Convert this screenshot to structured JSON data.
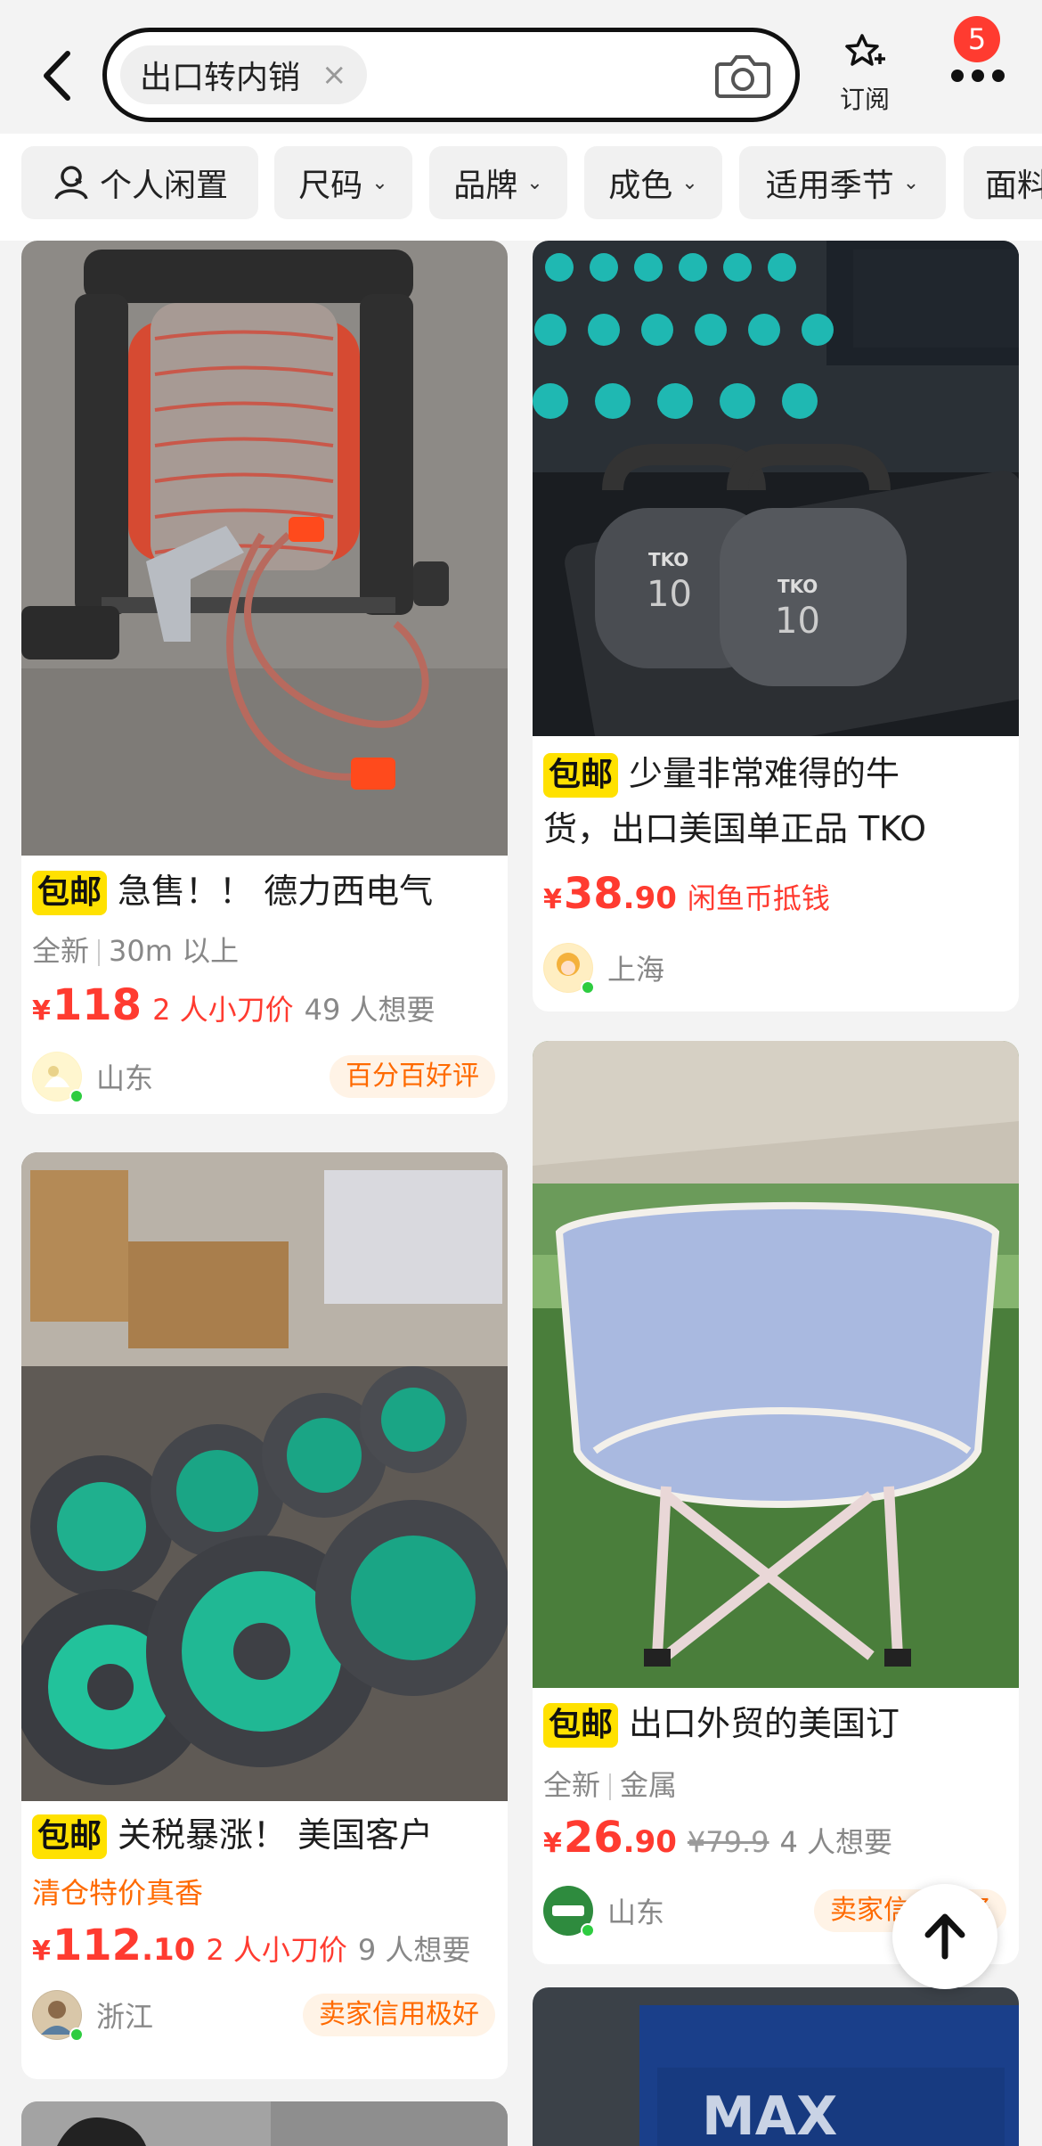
{
  "search": {
    "query": "出口转内销",
    "close_symbol": "×"
  },
  "header": {
    "subscribe_label": "订阅",
    "notification_count": "5"
  },
  "filters": [
    {
      "label": "个人闲置",
      "has_icon": true
    },
    {
      "label": "尺码"
    },
    {
      "label": "品牌"
    },
    {
      "label": "成色"
    },
    {
      "label": "适用季节"
    },
    {
      "label": "面料"
    }
  ],
  "caret": "⌄",
  "products": [
    {
      "tag": "包邮",
      "title": "急售！！ 德力西电气",
      "condition": "全新",
      "spec": "30m 以上",
      "yen": "¥",
      "price_int": "118",
      "price_dec": "",
      "bargain": "2 人小刀价",
      "wants": "49 人想要",
      "location": "山东",
      "reputation": "百分百好评",
      "colors": {
        "accent": "#ff3b30"
      }
    },
    {
      "tag": "包邮",
      "title_line1": "少量非常难得的牛",
      "title_line2": "货，出口美国单正品 TKO",
      "yen": "¥",
      "price_int": "38",
      "price_dec": ".90",
      "coin_note": "闲鱼币抵钱",
      "location": "上海"
    },
    {
      "tag": "包邮",
      "title": "出口外贸的美国订",
      "condition": "全新",
      "spec": "金属",
      "yen": "¥",
      "price_int": "26",
      "price_dec": ".90",
      "original_price": "¥79.9",
      "wants": "4 人想要",
      "location": "山东",
      "reputation": "卖家信用极好"
    },
    {
      "tag": "包邮",
      "title": "关税暴涨！ 美国客户",
      "promo": "清仓特价真香",
      "yen": "¥",
      "price_int": "112",
      "price_dec": ".10",
      "bargain": "2 人小刀价",
      "wants": "9 人想要",
      "location": "浙江",
      "reputation": "卖家信用极好"
    }
  ]
}
